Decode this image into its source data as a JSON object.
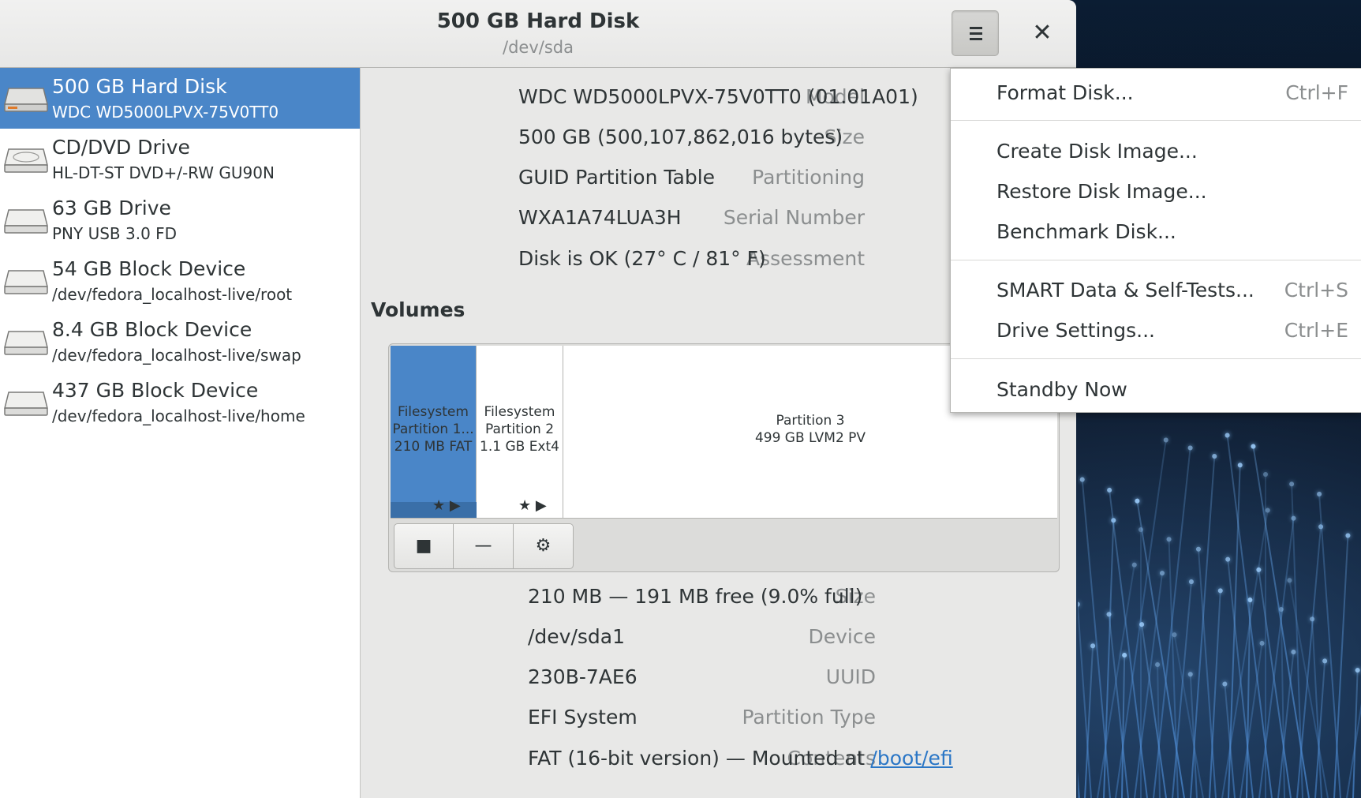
{
  "window": {
    "title": "500 GB Hard Disk",
    "subtitle": "/dev/sda",
    "close_glyph": "✕"
  },
  "sidebar": {
    "items": [
      {
        "name": "500 GB Hard Disk",
        "desc": "WDC WD5000LPVX-75V0TT0",
        "icon": "hard-disk-icon",
        "selected": true
      },
      {
        "name": "CD/DVD Drive",
        "desc": "HL-DT-ST DVD+/-RW GU90N",
        "icon": "optical-drive-icon",
        "selected": false
      },
      {
        "name": "63 GB Drive",
        "desc": "PNY USB 3.0 FD",
        "icon": "usb-drive-icon",
        "selected": false
      },
      {
        "name": "54 GB Block Device",
        "desc": "/dev/fedora_localhost-live/root",
        "icon": "block-device-icon",
        "selected": false
      },
      {
        "name": "8.4 GB Block Device",
        "desc": "/dev/fedora_localhost-live/swap",
        "icon": "block-device-icon",
        "selected": false
      },
      {
        "name": "437 GB Block Device",
        "desc": "/dev/fedora_localhost-live/home",
        "icon": "block-device-icon",
        "selected": false
      }
    ]
  },
  "drive_props": {
    "model_label": "Model",
    "model_value": "WDC WD5000LPVX-75V0TT0 (01.01A01)",
    "size_label": "Size",
    "size_value": "500 GB (500,107,862,016 bytes)",
    "partitioning_label": "Partitioning",
    "partitioning_value": "GUID Partition Table",
    "serial_label": "Serial Number",
    "serial_value": "WXA1A74LUA3H",
    "assessment_label": "Assessment",
    "assessment_value": "Disk is OK (27° C / 81° F)"
  },
  "volumes": {
    "heading": "Volumes",
    "segments": [
      {
        "line1": "Filesystem",
        "line2": "Partition 1...",
        "line3": "210 MB FAT",
        "selected": true,
        "marks": "★ ▶"
      },
      {
        "line1": "Filesystem",
        "line2": "Partition 2",
        "line3": "1.1 GB Ext4",
        "selected": false,
        "marks": "★ ▶"
      },
      {
        "line1": "Partition 3",
        "line2": "499 GB LVM2 PV",
        "selected": false
      }
    ],
    "toolbar": {
      "stop_glyph": "■",
      "delete_glyph": "—",
      "settings_glyph": "⚙"
    }
  },
  "partition_props": {
    "size_label": "Size",
    "size_value": "210 MB — 191 MB free (9.0% full)",
    "device_label": "Device",
    "device_value": "/dev/sda1",
    "uuid_label": "UUID",
    "uuid_value": "230B-7AE6",
    "type_label": "Partition Type",
    "type_value": "EFI System",
    "contents_label": "Contents",
    "contents_value": "FAT (16-bit version) — Mounted at ",
    "contents_link": "/boot/efi"
  },
  "menu": {
    "items": [
      {
        "label": "Format Disk...",
        "accel": "Ctrl+F"
      },
      {
        "label": "Create Disk Image...",
        "accel": ""
      },
      {
        "label": "Restore Disk Image...",
        "accel": ""
      },
      {
        "label": "Benchmark Disk...",
        "accel": ""
      },
      {
        "label": "SMART Data & Self-Tests...",
        "accel": "Ctrl+S"
      },
      {
        "label": "Drive Settings...",
        "accel": "Ctrl+E"
      },
      {
        "label": "Standby Now",
        "accel": ""
      }
    ]
  },
  "colors": {
    "selection": "#4a86c8",
    "link": "#2a76c6"
  }
}
